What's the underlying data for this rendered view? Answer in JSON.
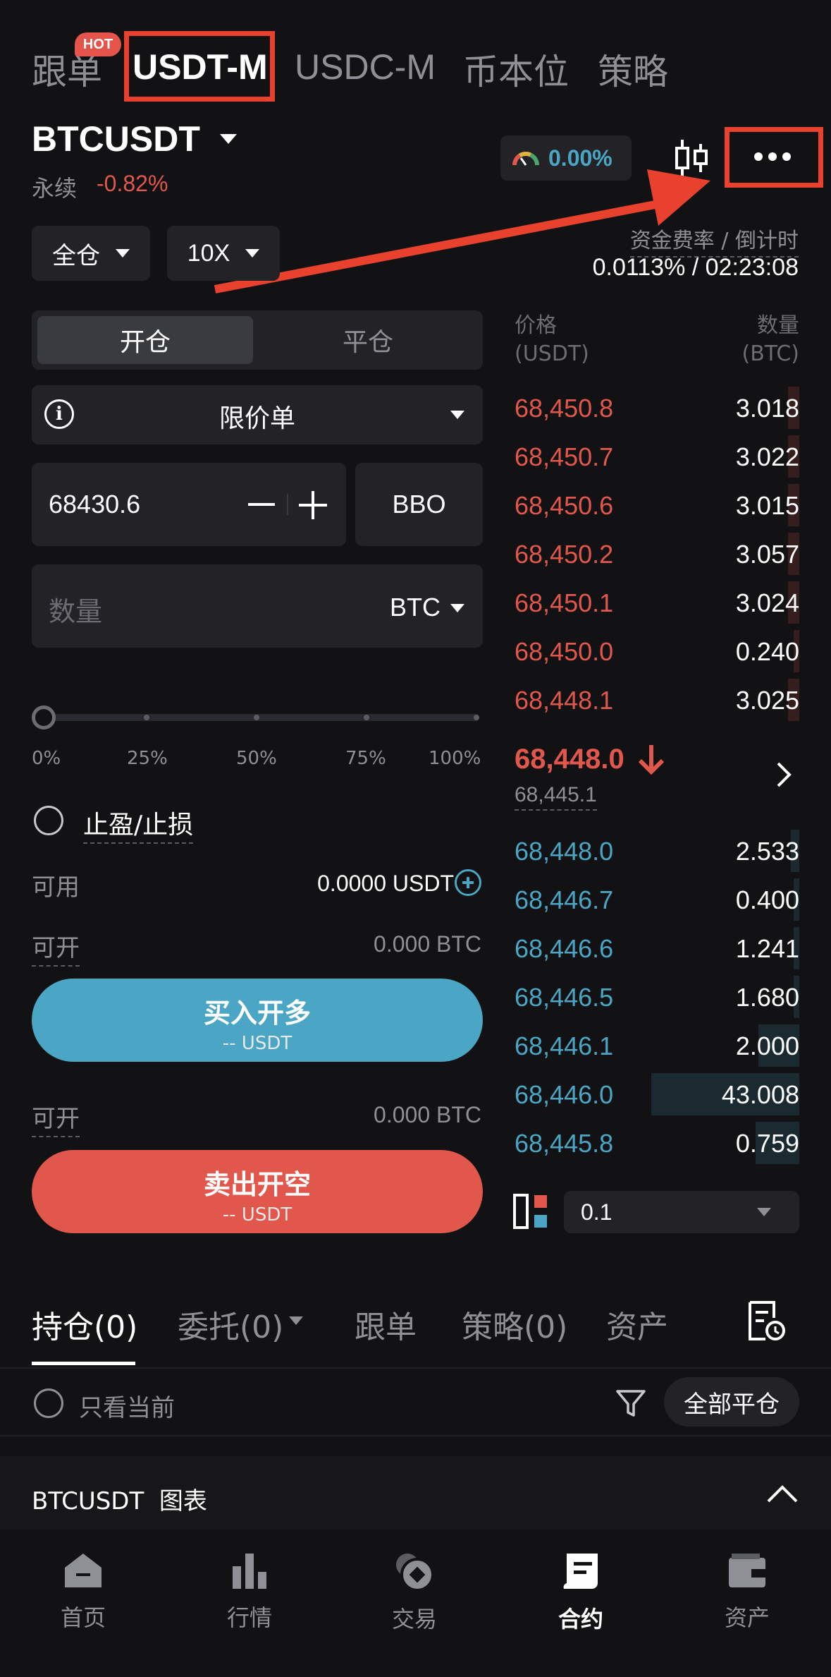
{
  "top_tabs": {
    "copy": "跟单",
    "hot": "HOT",
    "usdt_m": "USDT-M",
    "usdc_m": "USDC-M",
    "coin_m": "币本位",
    "strategy": "策略"
  },
  "header": {
    "symbol": "BTCUSDT",
    "perpetual": "永续",
    "change": "-0.82%",
    "gauge_value": "0.00%",
    "funding_label": "资金费率 / 倒计时",
    "funding_value": "0.0113% / 02:23:08"
  },
  "controls": {
    "margin_mode": "全仓",
    "leverage": "10X"
  },
  "form": {
    "open_tab": "开仓",
    "close_tab": "平仓",
    "order_type": "限价单",
    "price": "68430.6",
    "bbo": "BBO",
    "qty_placeholder": "数量",
    "qty_unit": "BTC",
    "percent_labels": [
      "0%",
      "25%",
      "50%",
      "75%",
      "100%"
    ],
    "slider_value_percent": 0,
    "tpsl": "止盈/止损",
    "available_label": "可用",
    "available_value": "0.0000 USDT",
    "can_open_label": "可开",
    "can_open_long": "0.000 BTC",
    "buy_label": "买入开多",
    "buy_sub": "-- USDT",
    "can_open_short": "0.000 BTC",
    "sell_label": "卖出开空",
    "sell_sub": "-- USDT"
  },
  "orderbook": {
    "price_header": "价格",
    "price_unit": "(USDT)",
    "qty_header": "数量",
    "qty_unit": "(BTC)",
    "asks": [
      {
        "price": "68,450.8",
        "qty": "3.018",
        "depth": 0.04
      },
      {
        "price": "68,450.7",
        "qty": "3.022",
        "depth": 0.04
      },
      {
        "price": "68,450.6",
        "qty": "3.015",
        "depth": 0.04
      },
      {
        "price": "68,450.2",
        "qty": "3.057",
        "depth": 0.04
      },
      {
        "price": "68,450.1",
        "qty": "3.024",
        "depth": 0.04
      },
      {
        "price": "68,450.0",
        "qty": "0.240",
        "depth": 0.01
      },
      {
        "price": "68,448.1",
        "qty": "3.025",
        "depth": 0.04
      }
    ],
    "last_price": "68,448.0",
    "mark_price": "68,445.1",
    "bids": [
      {
        "price": "68,448.0",
        "qty": "2.533",
        "depth": 0.03
      },
      {
        "price": "68,446.7",
        "qty": "0.400",
        "depth": 0.01
      },
      {
        "price": "68,446.6",
        "qty": "1.241",
        "depth": 0.02
      },
      {
        "price": "68,446.5",
        "qty": "1.680",
        "depth": 0.02
      },
      {
        "price": "68,446.1",
        "qty": "2.000",
        "depth": 0.14
      },
      {
        "price": "68,446.0",
        "qty": "43.008",
        "depth": 0.51
      },
      {
        "price": "68,445.8",
        "qty": "0.759",
        "depth": 0.15
      }
    ],
    "precision": "0.1"
  },
  "bottom_tabs": {
    "positions": "持仓(0)",
    "orders": "委托(0)",
    "copy": "跟单",
    "strategies": "策略(0)",
    "assets": "资产"
  },
  "positions_bar": {
    "only_current": "只看当前",
    "close_all": "全部平仓"
  },
  "chart_bar": {
    "label": "BTCUSDT  图表"
  },
  "nav": {
    "home": "首页",
    "markets": "行情",
    "trade": "交易",
    "futures": "合约",
    "assets": "资产"
  },
  "colors": {
    "ask": "#e2574c",
    "bid": "#4aa6c4",
    "buy_button": "#4aa6c4",
    "sell_button": "#e2574c",
    "highlight": "#e8412e"
  }
}
